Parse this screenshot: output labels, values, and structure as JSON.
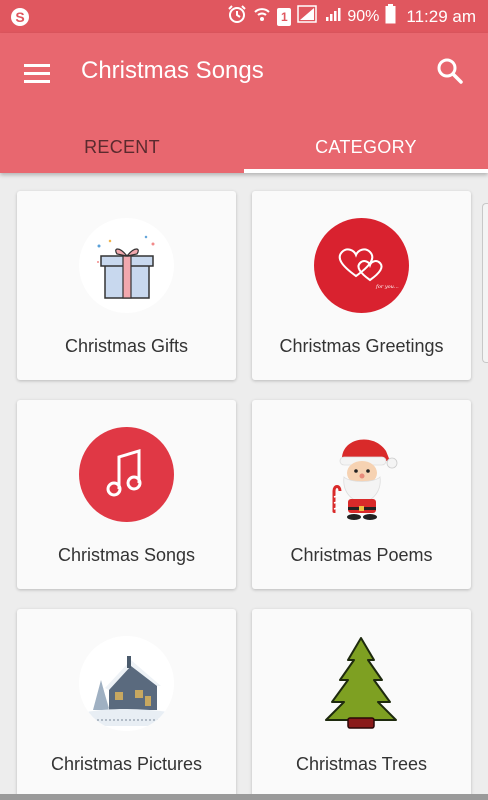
{
  "status_bar": {
    "battery": "90%",
    "time": "11:29 am",
    "sim_badge": "1",
    "icons": [
      "skype-icon",
      "alarm-icon",
      "wifi-call-icon",
      "sim-badge-icon",
      "signal-icon",
      "signal-icon-2",
      "battery-icon"
    ]
  },
  "app_bar": {
    "title": "Christmas Songs",
    "color": "#e8676f"
  },
  "tabs": [
    {
      "label": "RECENT",
      "active": false
    },
    {
      "label": "CATEGORY",
      "active": true
    }
  ],
  "categories": [
    {
      "label": "Christmas Gifts",
      "icon": "gift-icon"
    },
    {
      "label": "Christmas Greetings",
      "icon": "hearts-icon"
    },
    {
      "label": "Christmas Songs",
      "icon": "music-note-icon"
    },
    {
      "label": "Christmas Poems",
      "icon": "santa-icon"
    },
    {
      "label": "Christmas Pictures",
      "icon": "snowy-house-icon"
    },
    {
      "label": "Christmas Trees",
      "icon": "christmas-tree-icon"
    }
  ]
}
